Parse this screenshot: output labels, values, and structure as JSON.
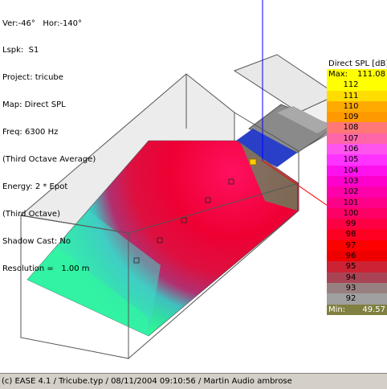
{
  "info_lines": [
    "Ver:-46°   Hor:-140°",
    "Lspk:  S1",
    "Project: tricube",
    "Map: Direct SPL",
    "Freq: 6300 Hz",
    "(Third Octave Average)",
    "Energy: 2 * Epot",
    "(Third Octave)",
    "Shadow Cast: No",
    "Resolution =   1.00 m"
  ],
  "legend": {
    "title": "Direct SPL [dB]",
    "max_label": "Max:",
    "max_value": "111.08",
    "min_label": "Min:",
    "min_value": "49.57",
    "max_color": "#ffff00",
    "min_color": "#808040",
    "levels": [
      {
        "label": "112",
        "color": "#ffff00"
      },
      {
        "label": "111",
        "color": "#ffdd00"
      },
      {
        "label": "110",
        "color": "#ffaa00"
      },
      {
        "label": "109",
        "color": "#ff9900"
      },
      {
        "label": "108",
        "color": "#ff7777"
      },
      {
        "label": "107",
        "color": "#ff66aa"
      },
      {
        "label": "106",
        "color": "#ff55ee"
      },
      {
        "label": "105",
        "color": "#ff33ff"
      },
      {
        "label": "104",
        "color": "#ff11ee"
      },
      {
        "label": "103",
        "color": "#ff00cc"
      },
      {
        "label": "102",
        "color": "#ff00aa"
      },
      {
        "label": "101",
        "color": "#ff0088"
      },
      {
        "label": "100",
        "color": "#ff0066"
      },
      {
        "label": "99",
        "color": "#ff0044"
      },
      {
        "label": "98",
        "color": "#ff0022"
      },
      {
        "label": "97",
        "color": "#ff0000"
      },
      {
        "label": "96",
        "color": "#ee0000"
      },
      {
        "label": "95",
        "color": "#cc2233"
      },
      {
        "label": "94",
        "color": "#aa4455"
      },
      {
        "label": "93",
        "color": "#998080"
      },
      {
        "label": "92",
        "color": "#a0a0a0"
      }
    ]
  },
  "status_text": "(c) EASE 4.1  / Tricube.typ  / 08/11/2004 09:10:56 / Martin Audio ambrose"
}
